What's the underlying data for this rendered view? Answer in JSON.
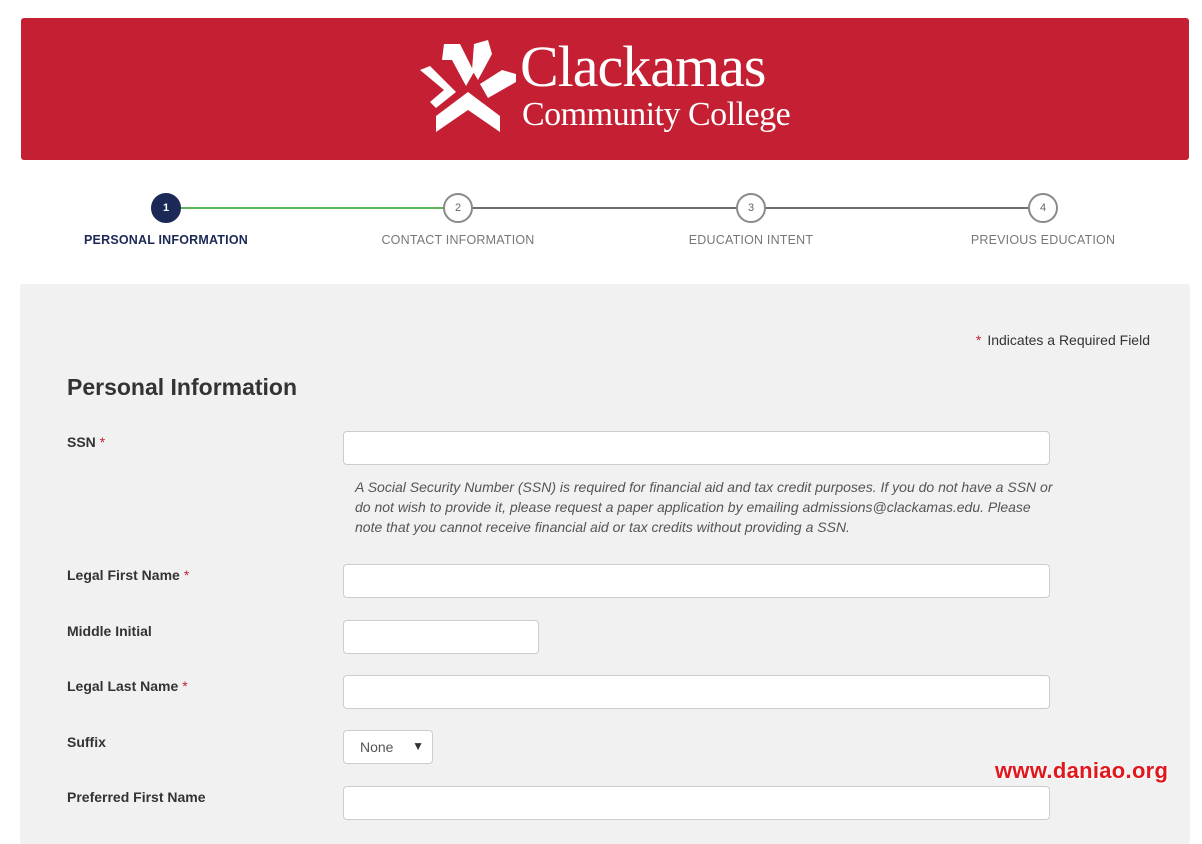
{
  "header": {
    "logo_title": "Clackamas",
    "logo_subtitle": "Community College",
    "brand_color": "#c41f33"
  },
  "stepper": {
    "steps": [
      {
        "number": "1",
        "label": "PERSONAL INFORMATION",
        "state": "active"
      },
      {
        "number": "2",
        "label": "CONTACT INFORMATION",
        "state": "upcoming"
      },
      {
        "number": "3",
        "label": "EDUCATION INTENT",
        "state": "upcoming"
      },
      {
        "number": "4",
        "label": "PREVIOUS EDUCATION",
        "state": "upcoming"
      }
    ],
    "active_color": "#1c2957",
    "progress_color": "#5cb85c"
  },
  "form": {
    "required_star": "*",
    "required_note": "Indicates a Required Field",
    "section_title": "Personal Information",
    "ssn_label": "SSN",
    "ssn_value": "",
    "ssn_help": "A Social Security Number (SSN) is required for financial aid and tax credit purposes. If you do not have a SSN or do not wish to provide it, please request a paper application by emailing admissions@clackamas.edu. Please note that you cannot receive financial aid or tax credits without providing a SSN.",
    "first_name_label": "Legal First Name",
    "first_name_value": "",
    "middle_initial_label": "Middle Initial",
    "middle_initial_value": "",
    "last_name_label": "Legal Last Name",
    "last_name_value": "",
    "suffix_label": "Suffix",
    "suffix_value": "None",
    "preferred_name_label": "Preferred First Name",
    "preferred_name_value": ""
  },
  "watermark": "www.daniao.org"
}
